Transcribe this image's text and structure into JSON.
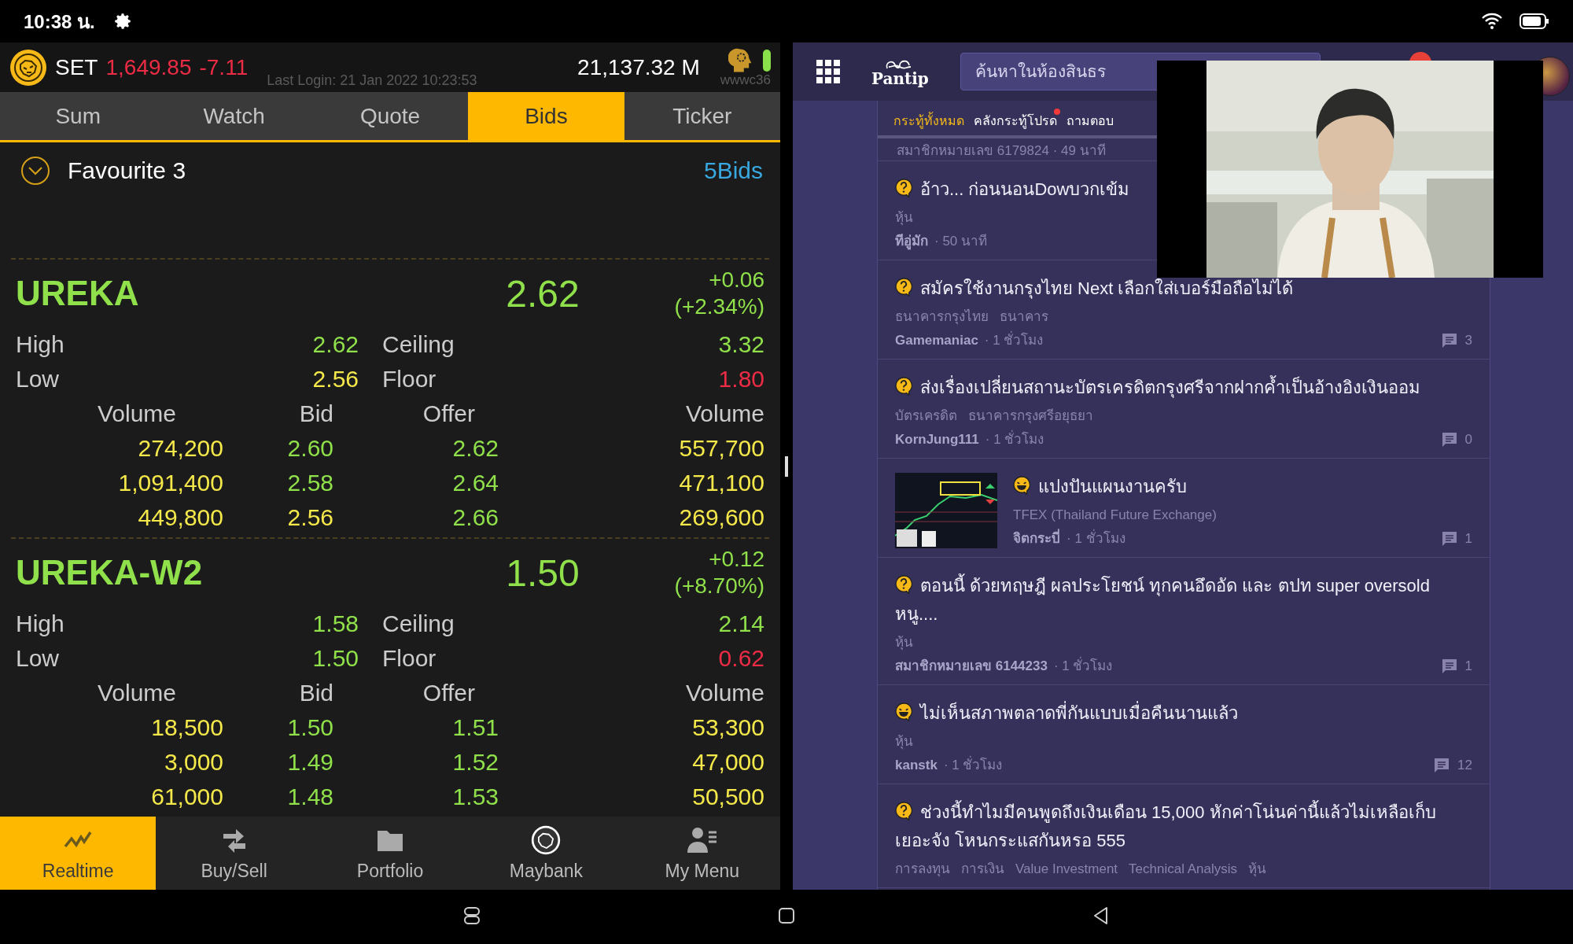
{
  "status_bar": {
    "time": "10:38 น."
  },
  "trading_app": {
    "index": {
      "name": "SET",
      "value": "1,649.85",
      "change": "-7.11"
    },
    "last_login": "Last Login: 21 Jan 2022 10:23:53",
    "turnover": "21,137.32 M",
    "user": "wwwc36",
    "tabs": [
      {
        "label": "Sum",
        "selected": false
      },
      {
        "label": "Watch",
        "selected": false
      },
      {
        "label": "Quote",
        "selected": false
      },
      {
        "label": "Bids",
        "selected": true
      },
      {
        "label": "Ticker",
        "selected": false
      }
    ],
    "favourite": "Favourite 3",
    "view_mode": "5Bids",
    "stocks": [
      {
        "symbol": "UREKA",
        "price": "2.62",
        "change": "+0.06",
        "change_pct": "(+2.34%)",
        "stats": [
          {
            "label": "High",
            "value": "2.62",
            "color": "#8fe04a"
          },
          {
            "label": "Ceiling",
            "value": "3.32",
            "color": "#8fe04a"
          },
          {
            "label": "Low",
            "value": "2.56",
            "color": "#f4e84a"
          },
          {
            "label": "Floor",
            "value": "1.80",
            "color": "#ec2b45"
          }
        ],
        "depth_headers": [
          "Volume",
          "Bid",
          "Offer",
          "Volume"
        ],
        "depth": [
          {
            "bid_volume": "274,200",
            "bid": {
              "value": "2.60",
              "color": "#8fe04a"
            },
            "offer": {
              "value": "2.62",
              "color": "#8fe04a"
            },
            "offer_volume": "557,700"
          },
          {
            "bid_volume": "1,091,400",
            "bid": {
              "value": "2.58",
              "color": "#8fe04a"
            },
            "offer": {
              "value": "2.64",
              "color": "#8fe04a"
            },
            "offer_volume": "471,100"
          },
          {
            "bid_volume": "449,800",
            "bid": {
              "value": "2.56",
              "color": "#f4e84a"
            },
            "offer": {
              "value": "2.66",
              "color": "#8fe04a"
            },
            "offer_volume": "269,600"
          }
        ]
      },
      {
        "symbol": "UREKA-W2",
        "price": "1.50",
        "change": "+0.12",
        "change_pct": "(+8.70%)",
        "stats": [
          {
            "label": "High",
            "value": "1.58",
            "color": "#8fe04a"
          },
          {
            "label": "Ceiling",
            "value": "2.14",
            "color": "#8fe04a"
          },
          {
            "label": "Low",
            "value": "1.50",
            "color": "#8fe04a"
          },
          {
            "label": "Floor",
            "value": "0.62",
            "color": "#ec2b45"
          }
        ],
        "depth_headers": [
          "Volume",
          "Bid",
          "Offer",
          "Volume"
        ],
        "depth": [
          {
            "bid_volume": "18,500",
            "bid": {
              "value": "1.50",
              "color": "#8fe04a"
            },
            "offer": {
              "value": "1.51",
              "color": "#8fe04a"
            },
            "offer_volume": "53,300"
          },
          {
            "bid_volume": "3,000",
            "bid": {
              "value": "1.49",
              "color": "#8fe04a"
            },
            "offer": {
              "value": "1.52",
              "color": "#8fe04a"
            },
            "offer_volume": "47,000"
          },
          {
            "bid_volume": "61,000",
            "bid": {
              "value": "1.48",
              "color": "#8fe04a"
            },
            "offer": {
              "value": "1.53",
              "color": "#8fe04a"
            },
            "offer_volume": "50,500"
          }
        ]
      }
    ],
    "bottom_nav": [
      {
        "label": "Realtime",
        "selected": true
      },
      {
        "label": "Buy/Sell",
        "selected": false
      },
      {
        "label": "Portfolio",
        "selected": false
      },
      {
        "label": "Maybank",
        "selected": false
      },
      {
        "label": "My Menu",
        "selected": false
      }
    ]
  },
  "browser": {
    "site": "Pantip",
    "search": {
      "placeholder": "ค้นหาในห้องสินธร"
    },
    "tabs": [
      {
        "label": "กระทู้ทั้งหมด",
        "selected": true,
        "dot": false
      },
      {
        "label": "คลังกระทู้โปรด",
        "selected": false,
        "dot": true
      },
      {
        "label": "ถามตอบ",
        "selected": false,
        "dot": false
      }
    ],
    "partial_meta": "สมาชิกหมายเลข 6179824 · 49 นาที",
    "posts": [
      {
        "kind": "question",
        "title": "อ้าว... ก่อนนอนDowบวกเข้ม",
        "tags": [
          "หุ้น"
        ],
        "author": "ทีอู่มัก",
        "time": "· 50 นาที"
      },
      {
        "kind": "question",
        "title": "สมัครใช้งานกรุงไทย Next เลือกใส่เบอร์มือถือไม่ได้",
        "tags": [
          "ธนาคารกรุงไทย",
          "ธนาคาร"
        ],
        "author": "Gamemaniac",
        "time": "· 1 ชั่วโมง",
        "comments": "3"
      },
      {
        "kind": "question",
        "title": "ส่งเรื่องเปลี่ยนสถานะบัตรเครดิตกรุงศรีจากฝากค้ำเป็นอ้างอิงเงินออม",
        "tags": [
          "บัตรเครดิต",
          "ธนาคารกรุงศรีอยุธยา"
        ],
        "author": "KornJung111",
        "time": "· 1 ชั่วโมง",
        "comments": "0"
      },
      {
        "kind": "chat",
        "thumbnail": {
          "kind": "picture"
        },
        "title": "แปงปันแผนงานครับ",
        "tags": [
          "TFEX (Thailand Future Exchange)"
        ],
        "author": "จิตกระบี่",
        "time": "· 1 ชั่วโมง",
        "comments": "1"
      },
      {
        "kind": "question",
        "title": "ตอนนี้ ด้วยทฤษฎี ผลประโยชน์ ทุกคนอึดอัด และ ตปท super oversold หนู....",
        "tags": [
          "หุ้น"
        ],
        "author": "สมาชิกหมายเลข 6144233",
        "time": "· 1 ชั่วโมง",
        "comments": "1"
      },
      {
        "kind": "chat",
        "title": "ไม่เห็นสภาพตลาดพี่กันแบบเมื่อคืนนานแล้ว",
        "tags": [
          "หุ้น"
        ],
        "author": "kanstk",
        "time": "· 1 ชั่วโมง",
        "comments": "12"
      },
      {
        "kind": "question",
        "title": "ช่วงนี้ทำไมมีคนพูดถึงเงินเดือน 15,000 หักค่าโน่นค่านี้แล้วไม่เหลือเก็บ เยอะจัง โหนกระแสกันหรอ 555",
        "tags": [
          "การลงทุน",
          "การเงิน",
          "Value Investment",
          "Technical Analysis",
          "หุ้น"
        ]
      }
    ]
  },
  "video": {
    "kind": "picture"
  }
}
